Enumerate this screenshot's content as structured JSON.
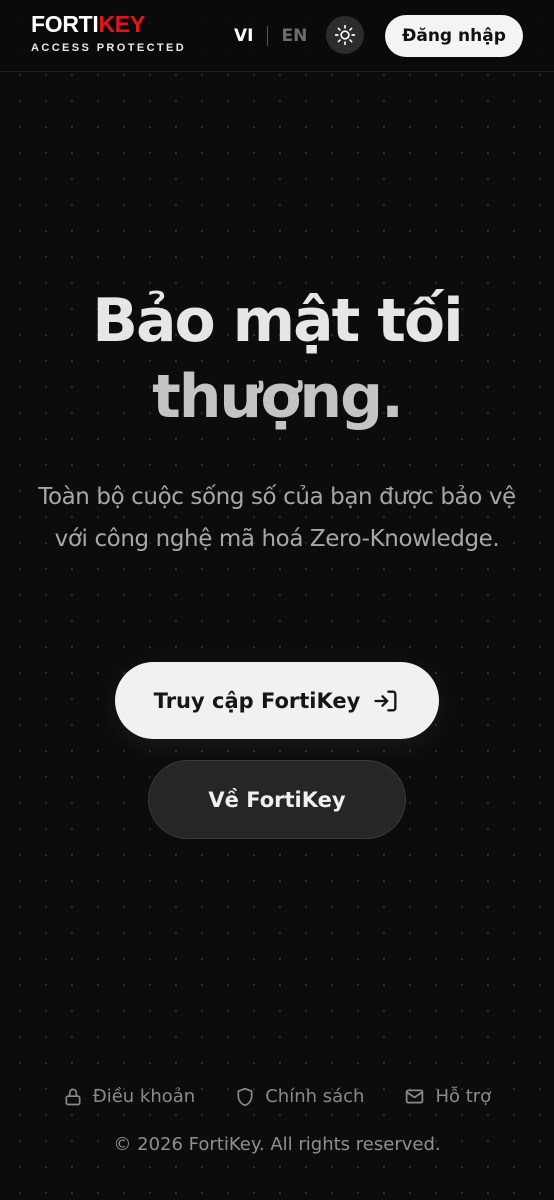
{
  "header": {
    "logo_part1": "FORTI",
    "logo_part2": "KEY",
    "logo_tagline": "ACCESS PROTECTED",
    "lang_vi": "VI",
    "lang_en": "EN",
    "active_language": "VI",
    "theme_icon": "sun-icon",
    "login_label": "Đăng nhập"
  },
  "hero": {
    "title_line1": "Bảo mật tối",
    "title_line2": "thượng.",
    "subtitle": "Toàn bộ cuộc sống số của bạn được bảo vệ với công nghệ mã hoá Zero-Knowledge.",
    "primary_label": "Truy cập FortiKey",
    "primary_icon": "login-arrow-icon",
    "secondary_label": "Về FortiKey"
  },
  "footer": {
    "links": [
      {
        "label": "Điều khoản",
        "icon": "lock-icon"
      },
      {
        "label": "Chính sách",
        "icon": "shield-icon"
      },
      {
        "label": "Hỗ trợ",
        "icon": "mail-icon"
      }
    ],
    "copyright": "© 2026 FortiKey. All rights reserved."
  },
  "colors": {
    "background": "#0c0c0c",
    "brand_red": "#e3141d",
    "button_light": "#f1f1f1",
    "button_dark": "#262626"
  }
}
